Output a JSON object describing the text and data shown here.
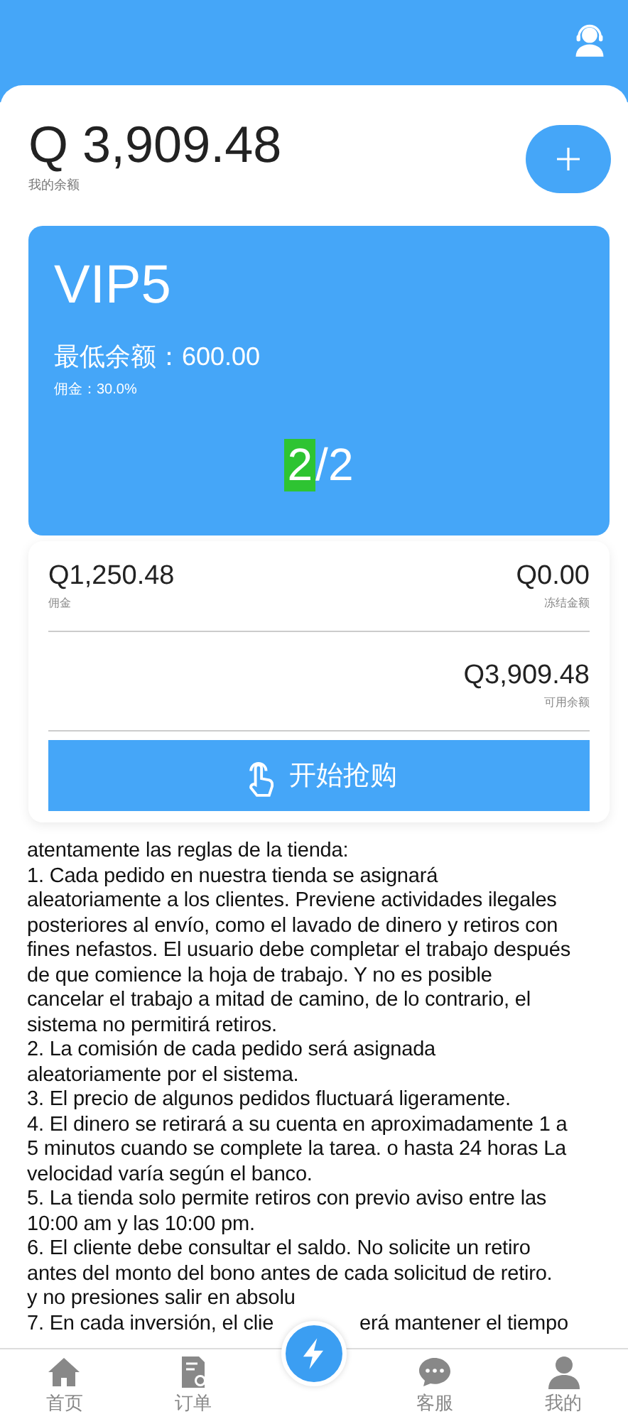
{
  "header": {
    "balance": "Q 3,909.48",
    "balance_label": "我的余额"
  },
  "vip": {
    "level": "VIP5",
    "min_balance": "最低余额：600.00",
    "commission": "佣金：30.0%",
    "done": "2",
    "total": "/2"
  },
  "stats": [
    {
      "value": "Q1,250.48",
      "label": "佣金"
    },
    {
      "value": "Q0.00",
      "label": "冻结金额"
    },
    {
      "value": "Q3,909.48",
      "label": "可用余额"
    }
  ],
  "start_button": "开始抢购",
  "rules": [
    "atentamente las reglas de la tienda:",
    "1. Cada pedido en nuestra tienda se asignará",
    "aleatoriamente a los clientes. Previene actividades ilegales",
    "posteriores al envío, como el lavado de dinero y retiros con",
    "fines nefastos. El usuario debe completar el trabajo después",
    "de que comience la hoja de trabajo. Y no es posible",
    "cancelar el trabajo a mitad de camino, de lo contrario, el",
    "sistema no permitirá retiros.",
    "2. La comisión de cada pedido será asignada",
    "aleatoriamente por el sistema.",
    "3. El precio de algunos pedidos fluctuará ligeramente.",
    "4. El dinero se retirará a su cuenta en aproximadamente 1 a",
    "5 minutos cuando se complete la tarea. o hasta 24 horas La",
    "velocidad varía según el banco.",
    "5. La tienda solo permite retiros con previo aviso entre las",
    "10:00 am y las 10:00 pm.",
    "6. El cliente debe consultar el saldo. No solicite un retiro",
    "antes del monto del bono antes de cada solicitud de retiro.",
    "y no presiones salir en absolu"
  ],
  "covered_rule": {
    "before": "7. En cada inversión, el clie",
    "after": "erá mantener el tiempo"
  },
  "tabs": [
    {
      "label": "首页",
      "kind": "home"
    },
    {
      "label": "订单",
      "kind": "orders"
    },
    {
      "kind": "center"
    },
    {
      "label": "客服",
      "kind": "chat"
    },
    {
      "label": "我的",
      "kind": "profile"
    }
  ]
}
